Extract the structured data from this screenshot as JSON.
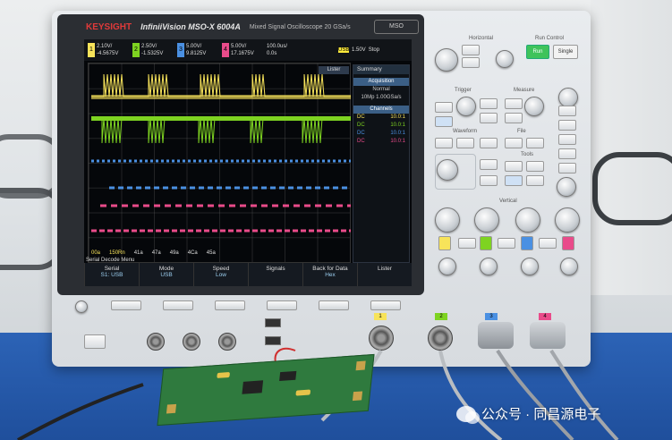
{
  "scope": {
    "brand": "KEYSIGHT",
    "model": "InfiniiVision MSO-X 6004A",
    "subtitle": "Mixed Signal Oscilloscope   20 GSa/s",
    "badge": "MSO"
  },
  "channels": [
    {
      "num": "1",
      "scale": "2.10V/",
      "offset": "-4.5675V",
      "color": "#f7e35a"
    },
    {
      "num": "2",
      "scale": "2.50V/",
      "offset": "-1.5325V",
      "color": "#7ed321"
    },
    {
      "num": "3",
      "scale": "5.00V/",
      "offset": "9.8125V",
      "color": "#4a90e2"
    },
    {
      "num": "4",
      "scale": "5.00V/",
      "offset": "17.1675V",
      "color": "#e94b8a"
    }
  ],
  "timebase": {
    "scale": "100.0us/",
    "delay": "0.0s"
  },
  "trigger": {
    "source": "USB",
    "level": "1.50V",
    "mode": "Stop"
  },
  "lister_button": "Lister",
  "summary_panel": {
    "title": "Summary",
    "acquisition_label": "Acquisition",
    "acq_mode": "Normal",
    "acq_rate": "10Mp   1.00GSa/s",
    "channels_label": "Channels",
    "channel_rows": [
      {
        "coupling": "DC",
        "ratio": "10.0:1",
        "color": "#f7e35a"
      },
      {
        "coupling": "DC",
        "ratio": "10.0:1",
        "color": "#7ed321"
      },
      {
        "coupling": "DC",
        "ratio": "10.0:1",
        "color": "#4a90e2"
      },
      {
        "coupling": "DC",
        "ratio": "10.0:1",
        "color": "#e94b8a"
      }
    ]
  },
  "decode_row": [
    "00a",
    "150Rn",
    "41a",
    "47a",
    "49a",
    "4Ca",
    "45a"
  ],
  "softkey_menu": {
    "header": "Serial Decode Menu",
    "keys": [
      {
        "label": "Serial",
        "value": "S1: USB"
      },
      {
        "label": "Mode",
        "value": "USB"
      },
      {
        "label": "Speed",
        "value": "Low"
      },
      {
        "label": "Signals",
        "value": ""
      },
      {
        "label": "Back for Data",
        "value": "Hex"
      },
      {
        "label": "Lister",
        "value": ""
      }
    ]
  },
  "front_panel": {
    "horizontal_label": "Horizontal",
    "run_control_label": "Run Control",
    "run_label": "Run",
    "single_label": "Single",
    "trigger_label": "Trigger",
    "measure_label": "Measure",
    "waveform_label": "Waveform",
    "file_label": "File",
    "tools_label": "Tools",
    "vertical_label": "Vertical"
  },
  "channel_input_labels": [
    "1",
    "2",
    "3",
    "4"
  ],
  "watermark": "公众号 · 同昌源电子"
}
